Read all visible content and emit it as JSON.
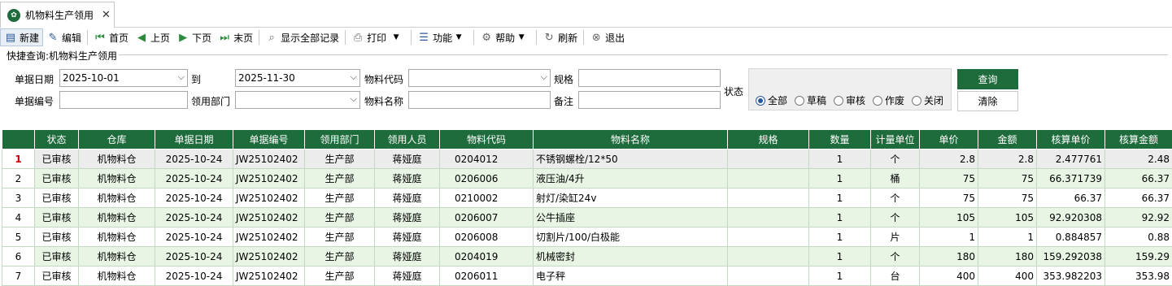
{
  "tab": {
    "title": "机物料生产领用",
    "close": "✕",
    "icon": "wx-icon"
  },
  "toolbar": {
    "new": "新建",
    "edit": "编辑",
    "first": "首页",
    "prev": "上页",
    "next": "下页",
    "last": "末页",
    "show_all": "显示全部记录",
    "print": "打印",
    "function": "功能",
    "help": "帮助",
    "refresh": "刷新",
    "exit": "退出"
  },
  "quick_query": {
    "title": "快捷查询:机物料生产领用",
    "date_label": "单据日期",
    "date_from": "2025-10-01",
    "to_label": "到",
    "date_to": "2025-11-30",
    "material_code_label": "物料代码",
    "material_code": "",
    "spec_label": "规格",
    "spec": "",
    "doc_no_label": "单据编号",
    "doc_no": "",
    "dept_label": "领用部门",
    "dept": "",
    "material_name_label": "物料名称",
    "material_name": "",
    "remark_label": "备注",
    "remark": "",
    "state_label": "状态",
    "states": [
      "全部",
      "草稿",
      "审核",
      "作废",
      "关闭"
    ],
    "selected_state": "全部",
    "query_button": "查询",
    "clear_button": "清除"
  },
  "grid": {
    "columns": [
      "状态",
      "仓库",
      "单据日期",
      "单据编号",
      "领用部门",
      "领用人员",
      "物料代码",
      "物料名称",
      "规格",
      "数量",
      "计量单位",
      "单价",
      "金额",
      "核算单价",
      "核算金额"
    ],
    "rows": [
      {
        "n": "1",
        "status": "已审核",
        "warehouse": "机物料仓",
        "date": "2025-10-24",
        "doc": "JW25102402",
        "dept": "生产部",
        "person": "蒋娅庭",
        "code": "0204012",
        "name": "不锈钢螺栓/12*50",
        "spec": "",
        "qty": "1",
        "unit": "个",
        "price": "2.8",
        "amount": "2.8",
        "cost_price": "2.477761",
        "cost_amount": "2.48"
      },
      {
        "n": "2",
        "status": "已审核",
        "warehouse": "机物料仓",
        "date": "2025-10-24",
        "doc": "JW25102402",
        "dept": "生产部",
        "person": "蒋娅庭",
        "code": "0206006",
        "name": "液压油/4升",
        "spec": "",
        "qty": "1",
        "unit": "桶",
        "price": "75",
        "amount": "75",
        "cost_price": "66.371739",
        "cost_amount": "66.37"
      },
      {
        "n": "3",
        "status": "已审核",
        "warehouse": "机物料仓",
        "date": "2025-10-24",
        "doc": "JW25102402",
        "dept": "生产部",
        "person": "蒋娅庭",
        "code": "0210002",
        "name": "射灯/染缸24v",
        "spec": "",
        "qty": "1",
        "unit": "个",
        "price": "75",
        "amount": "75",
        "cost_price": "66.37",
        "cost_amount": "66.37"
      },
      {
        "n": "4",
        "status": "已审核",
        "warehouse": "机物料仓",
        "date": "2025-10-24",
        "doc": "JW25102402",
        "dept": "生产部",
        "person": "蒋娅庭",
        "code": "0206007",
        "name": "公牛插座",
        "spec": "",
        "qty": "1",
        "unit": "个",
        "price": "105",
        "amount": "105",
        "cost_price": "92.920308",
        "cost_amount": "92.92"
      },
      {
        "n": "5",
        "status": "已审核",
        "warehouse": "机物料仓",
        "date": "2025-10-24",
        "doc": "JW25102402",
        "dept": "生产部",
        "person": "蒋娅庭",
        "code": "0206008",
        "name": "切割片/100/白极能",
        "spec": "",
        "qty": "1",
        "unit": "片",
        "price": "1",
        "amount": "1",
        "cost_price": "0.884857",
        "cost_amount": "0.88"
      },
      {
        "n": "6",
        "status": "已审核",
        "warehouse": "机物料仓",
        "date": "2025-10-24",
        "doc": "JW25102402",
        "dept": "生产部",
        "person": "蒋娅庭",
        "code": "0204019",
        "name": "机械密封",
        "spec": "",
        "qty": "1",
        "unit": "个",
        "price": "180",
        "amount": "180",
        "cost_price": "159.292038",
        "cost_amount": "159.29"
      },
      {
        "n": "7",
        "status": "已审核",
        "warehouse": "机物料仓",
        "date": "2025-10-24",
        "doc": "JW25102402",
        "dept": "生产部",
        "person": "蒋娅庭",
        "code": "0206011",
        "name": "电子秤",
        "spec": "",
        "qty": "1",
        "unit": "台",
        "price": "400",
        "amount": "400",
        "cost_price": "353.982203",
        "cost_amount": "353.98"
      }
    ]
  }
}
